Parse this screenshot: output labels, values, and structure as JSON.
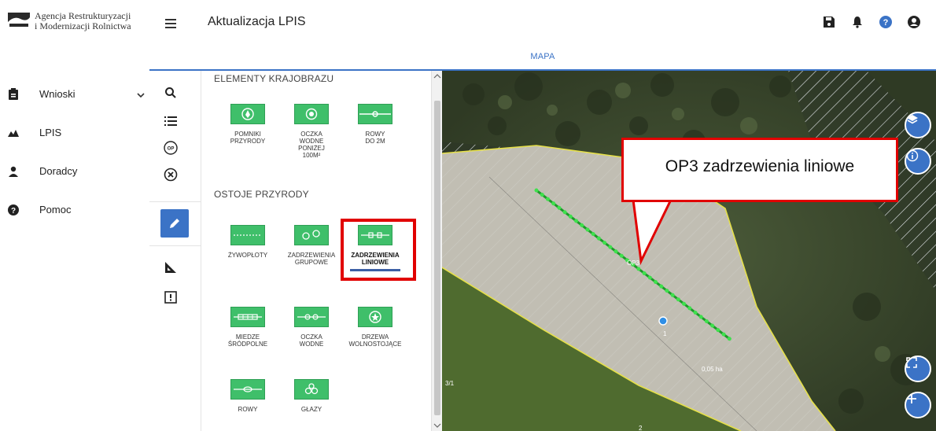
{
  "header": {
    "org_line1": "Agencja Restrukturyzacji",
    "org_line2": "i Modernizacji Rolnictwa",
    "app_title": "Aktualizacja LPIS",
    "icons": [
      "save-icon",
      "bell-icon",
      "help-icon",
      "user-icon"
    ]
  },
  "tabs": {
    "active": "MAPA"
  },
  "sidebar": {
    "items": [
      {
        "label": "Wnioski",
        "icon": "clipboard-icon",
        "expandable": true
      },
      {
        "label": "LPIS",
        "icon": "mountains-icon"
      },
      {
        "label": "Doradcy",
        "icon": "person-icon"
      },
      {
        "label": "Pomoc",
        "icon": "help-icon"
      }
    ]
  },
  "tools": [
    "search-icon",
    "list-icon",
    "op-icon",
    "clear-icon",
    "edit-icon",
    "measure-icon",
    "report-icon"
  ],
  "panel": {
    "section1_title": "ELEMENTY KRAJOBRAZU",
    "section1_items": [
      {
        "l1": "POMNIKI",
        "l2": "PRZYRODY",
        "l3": "",
        "l4": ""
      },
      {
        "l1": "OCZKA",
        "l2": "WODNE",
        "l3": "PONIŻEJ",
        "l4": "100M²"
      },
      {
        "l1": "ROWY",
        "l2": "DO 2M",
        "l3": "",
        "l4": ""
      }
    ],
    "section2_title": "OSTOJE PRZYRODY",
    "section2_items": [
      {
        "l1": "ŻYWOPŁOTY",
        "l2": ""
      },
      {
        "l1": "ZADRZEWIENIA",
        "l2": "GRUPOWE"
      },
      {
        "l1": "ZADRZEWIENIA",
        "l2": "LINIOWE",
        "selected": true
      },
      {
        "l1": "MIEDZE",
        "l2": "ŚRÓDPOLNE"
      },
      {
        "l1": "OCZKA",
        "l2": "WODNE"
      },
      {
        "l1": "DRZEWA",
        "l2": "WOLNOSTOJĄCE"
      },
      {
        "l1": "ROWY",
        "l2": ""
      },
      {
        "l1": "GŁAZY",
        "l2": ""
      }
    ]
  },
  "map": {
    "labels": {
      "op3": "OP3",
      "parcel_1": "1",
      "area": "0,05 ha",
      "parcel_31": "3/1",
      "parcel_2": "2"
    },
    "controls": [
      "layers-icon",
      "info-icon",
      "fullscreen-icon",
      "zoom-in-icon"
    ]
  },
  "callout": {
    "text": "OP3 zadrzewienia liniowe"
  },
  "colors": {
    "accent": "#3b73c6",
    "green": "#3fbf6a",
    "highlight": "#e10000"
  }
}
